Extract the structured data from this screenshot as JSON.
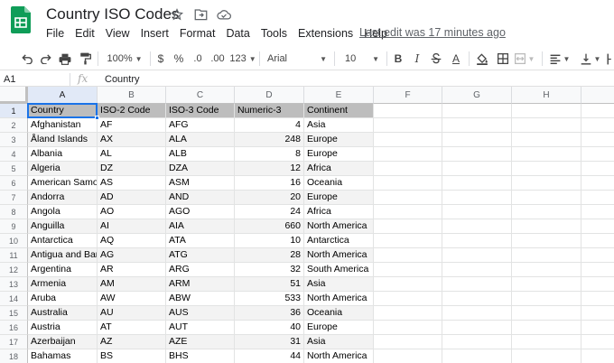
{
  "app": {
    "title": "Country ISO Codes",
    "last_edit": "Last edit was 17 minutes ago",
    "brand_color": "#0f9d58"
  },
  "menu": [
    "File",
    "Edit",
    "View",
    "Insert",
    "Format",
    "Data",
    "Tools",
    "Extensions",
    "Help"
  ],
  "toolbar": {
    "zoom": "100%",
    "currency": "$",
    "percent": "%",
    "dec_less": ".0",
    "dec_more": ".00",
    "more_formats": "123",
    "font": "Arial",
    "font_size": "10",
    "bold": "B",
    "italic": "I",
    "text_color_glyph": "A"
  },
  "formula_bar": {
    "cell_ref": "A1",
    "fx": "fx",
    "value": "Country"
  },
  "grid": {
    "columns": [
      "A",
      "B",
      "C",
      "D",
      "E",
      "F",
      "G",
      "H"
    ],
    "headers": [
      "Country",
      "ISO-2 Code",
      "ISO-3 Code",
      "Numeric-3",
      "Continent"
    ],
    "rows": [
      [
        "Afghanistan",
        "AF",
        "AFG",
        "4",
        "Asia"
      ],
      [
        "Åland Islands",
        "AX",
        "ALA",
        "248",
        "Europe"
      ],
      [
        "Albania",
        "AL",
        "ALB",
        "8",
        "Europe"
      ],
      [
        "Algeria",
        "DZ",
        "DZA",
        "12",
        "Africa"
      ],
      [
        "American Samoa",
        "AS",
        "ASM",
        "16",
        "Oceania"
      ],
      [
        "Andorra",
        "AD",
        "AND",
        "20",
        "Europe"
      ],
      [
        "Angola",
        "AO",
        "AGO",
        "24",
        "Africa"
      ],
      [
        "Anguilla",
        "AI",
        "AIA",
        "660",
        "North America"
      ],
      [
        "Antarctica",
        "AQ",
        "ATA",
        "10",
        "Antarctica"
      ],
      [
        "Antigua and Barbuda",
        "AG",
        "ATG",
        "28",
        "North America"
      ],
      [
        "Argentina",
        "AR",
        "ARG",
        "32",
        "South America"
      ],
      [
        "Armenia",
        "AM",
        "ARM",
        "51",
        "Asia"
      ],
      [
        "Aruba",
        "AW",
        "ABW",
        "533",
        "North America"
      ],
      [
        "Australia",
        "AU",
        "AUS",
        "36",
        "Oceania"
      ],
      [
        "Austria",
        "AT",
        "AUT",
        "40",
        "Europe"
      ],
      [
        "Azerbaijan",
        "AZ",
        "AZE",
        "31",
        "Asia"
      ],
      [
        "Bahamas",
        "BS",
        "BHS",
        "44",
        "North America"
      ]
    ]
  }
}
